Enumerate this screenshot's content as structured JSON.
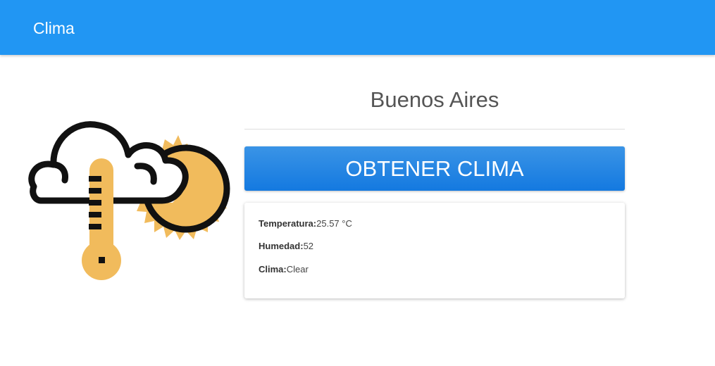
{
  "navbar": {
    "brand": "Clima"
  },
  "illustration": {
    "sun_color": "#f1bb5c",
    "cloud_stroke": "#111111",
    "thermometer_color": "#f1bb5c"
  },
  "main": {
    "city": "Buenos Aires",
    "button_label": "OBTENER CLIMA",
    "accent": "#2196f3"
  },
  "weather": {
    "temperature_label": "Temperatura:",
    "temperature_value": "25.57 °C",
    "humidity_label": "Humedad:",
    "humidity_value": "52",
    "condition_label": "Clima:",
    "condition_value": "Clear"
  }
}
